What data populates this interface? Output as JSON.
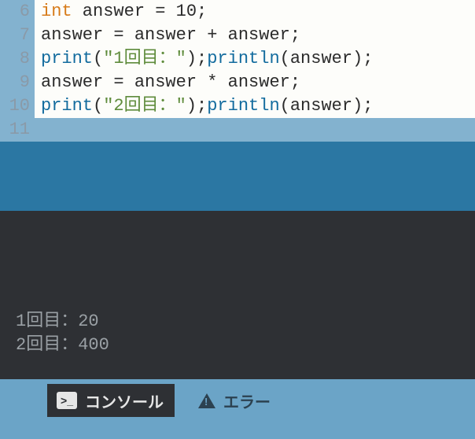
{
  "editor": {
    "lines": [
      {
        "num": "6",
        "tokens": [
          {
            "t": "int",
            "c": "kw-type"
          },
          {
            "t": " answer ",
            "c": "op"
          },
          {
            "t": "=",
            "c": "op"
          },
          {
            "t": " ",
            "c": "op"
          },
          {
            "t": "10",
            "c": "num"
          },
          {
            "t": ";",
            "c": "op"
          }
        ]
      },
      {
        "num": "7",
        "tokens": [
          {
            "t": "answer ",
            "c": "op"
          },
          {
            "t": "=",
            "c": "op"
          },
          {
            "t": " answer ",
            "c": "op"
          },
          {
            "t": "+",
            "c": "op"
          },
          {
            "t": " answer",
            "c": "op"
          },
          {
            "t": ";",
            "c": "op"
          }
        ]
      },
      {
        "num": "8",
        "tokens": [
          {
            "t": "print",
            "c": "fn"
          },
          {
            "t": "(",
            "c": "op"
          },
          {
            "t": "\"1回目：\"",
            "c": "str"
          },
          {
            "t": ")",
            "c": "op"
          },
          {
            "t": ";",
            "c": "op"
          },
          {
            "t": "println",
            "c": "fn"
          },
          {
            "t": "(",
            "c": "op"
          },
          {
            "t": "answer",
            "c": "op"
          },
          {
            "t": ")",
            "c": "op"
          },
          {
            "t": ";",
            "c": "op"
          }
        ]
      },
      {
        "num": "9",
        "tokens": [
          {
            "t": "answer ",
            "c": "op"
          },
          {
            "t": "=",
            "c": "op"
          },
          {
            "t": " answer ",
            "c": "op"
          },
          {
            "t": "*",
            "c": "op"
          },
          {
            "t": " answer",
            "c": "op"
          },
          {
            "t": ";",
            "c": "op"
          }
        ]
      },
      {
        "num": "10",
        "tokens": [
          {
            "t": "print",
            "c": "fn"
          },
          {
            "t": "(",
            "c": "op"
          },
          {
            "t": "\"2回目：\"",
            "c": "str"
          },
          {
            "t": ")",
            "c": "op"
          },
          {
            "t": ";",
            "c": "op"
          },
          {
            "t": "println",
            "c": "fn"
          },
          {
            "t": "(",
            "c": "op"
          },
          {
            "t": "answer",
            "c": "op"
          },
          {
            "t": ")",
            "c": "op"
          },
          {
            "t": ";",
            "c": "op"
          }
        ]
      },
      {
        "num": "11",
        "tokens": []
      }
    ]
  },
  "console": {
    "lines": [
      "1回目：20",
      "2回目：400"
    ]
  },
  "tabs": {
    "console_label": "コンソール",
    "errors_label": "エラー",
    "console_icon_glyph": ">_"
  }
}
